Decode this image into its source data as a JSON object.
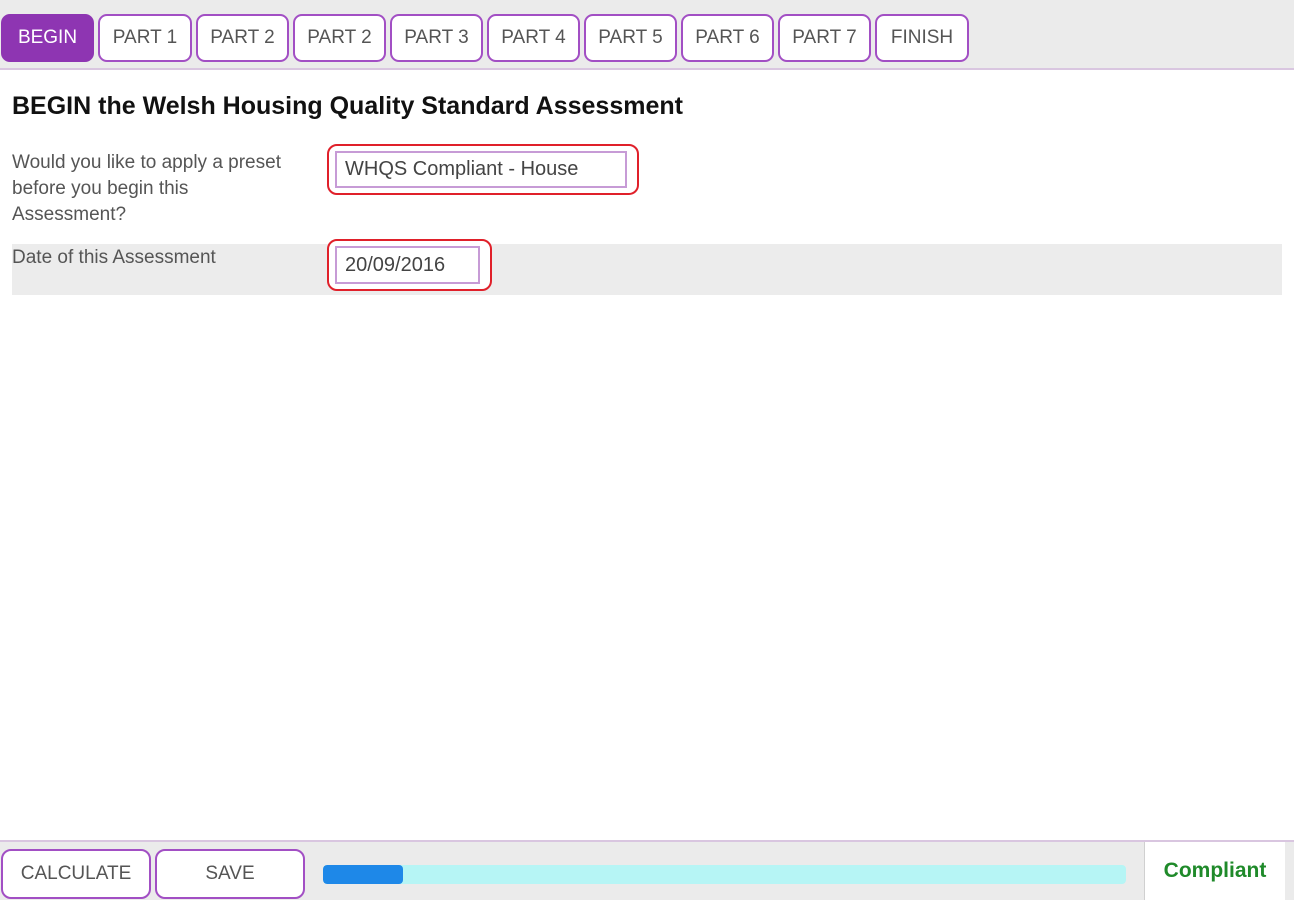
{
  "tabs": [
    {
      "label": "BEGIN",
      "active": true
    },
    {
      "label": "PART 1",
      "active": false
    },
    {
      "label": "PART 2",
      "active": false
    },
    {
      "label": "PART 2",
      "active": false
    },
    {
      "label": "PART 3",
      "active": false
    },
    {
      "label": "PART 4",
      "active": false
    },
    {
      "label": "PART 5",
      "active": false
    },
    {
      "label": "PART 6",
      "active": false
    },
    {
      "label": "PART 7",
      "active": false
    },
    {
      "label": "FINISH",
      "active": false
    }
  ],
  "main": {
    "title": "BEGIN the Welsh Housing Quality Standard Assessment",
    "preset": {
      "label_lines": [
        "Would you like to apply a preset",
        "before you begin this",
        "Assessment?"
      ],
      "value": "WHQS Compliant - House"
    },
    "date": {
      "label": "Date of this Assessment",
      "value": "20/09/2016"
    }
  },
  "footer": {
    "calculate_label": "CALCULATE",
    "save_label": "SAVE",
    "progress_fraction": 0.1,
    "status": "Compliant"
  },
  "colors": {
    "accent": "#8e35b2",
    "highlight_border": "#e0202a",
    "progress_fill": "#1e88e8",
    "progress_track": "#b6f5f5",
    "status_text": "#1f8a2a"
  }
}
